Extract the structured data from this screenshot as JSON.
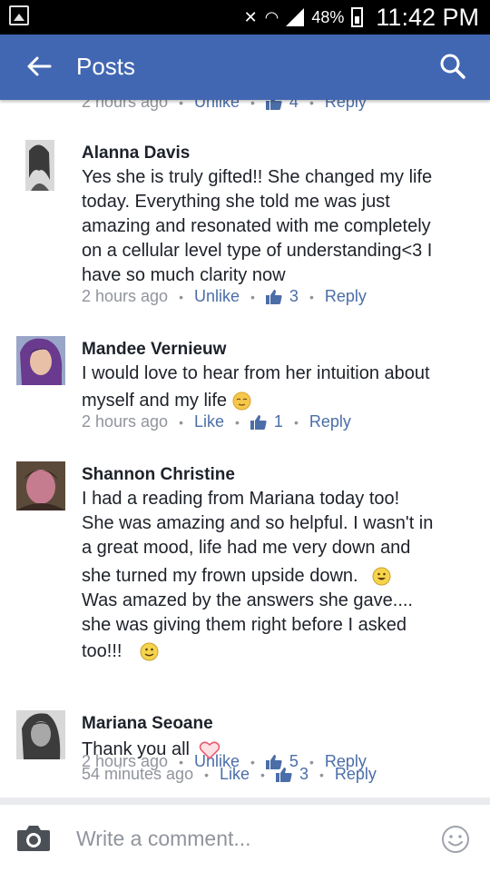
{
  "status_bar": {
    "battery": "48%",
    "time": "11:42 PM"
  },
  "header": {
    "title": "Posts"
  },
  "top_meta": {
    "time": "2 hours ago",
    "action": "Unlike",
    "likes": "4",
    "reply": "Reply"
  },
  "comments": [
    {
      "name": "Alanna Davis",
      "lines": [
        "Yes she is truly gifted!! She changed my life",
        "today. Everything she told me was just",
        "amazing and resonated with me completely",
        "on a cellular level type of understanding<3 I",
        "have so much clarity now"
      ],
      "time": "2 hours ago",
      "action": "Unlike",
      "likes": "3",
      "reply": "Reply"
    },
    {
      "name": "Mandee Vernieuw",
      "lines": [
        "I would love to hear from her intuition about",
        "myself and my life"
      ],
      "time": "2 hours ago",
      "action": "Like",
      "likes": "1",
      "reply": "Reply"
    },
    {
      "name": "Shannon Christine",
      "lines": [
        "I had a reading from Mariana today too!",
        "She was amazing and so helpful.  I wasn't in",
        "a great mood, life had me very down and",
        "she turned my frown upside down.",
        "Was amazed by the answers she gave....",
        "she was giving them right before I asked",
        "too!!!"
      ],
      "time": "2 hours ago",
      "action": "Unlike",
      "likes": "5",
      "reply": "Reply"
    },
    {
      "name": "Mariana Seoane",
      "lines": [
        "Thank you all"
      ],
      "time": "54 minutes ago",
      "action": "Like",
      "likes": "3",
      "reply": "Reply"
    }
  ],
  "composer": {
    "placeholder": "Write a comment..."
  },
  "icons": {
    "status_left": "gallery-icon",
    "back": "back-arrow-icon",
    "search": "search-icon",
    "like": "thumbs-up-icon",
    "camera": "camera-icon",
    "emoji": "smiley-icon"
  },
  "colors": {
    "header": "#4267b2",
    "link": "#4b6ea8",
    "meta": "#90949c",
    "text": "#1d2129"
  }
}
